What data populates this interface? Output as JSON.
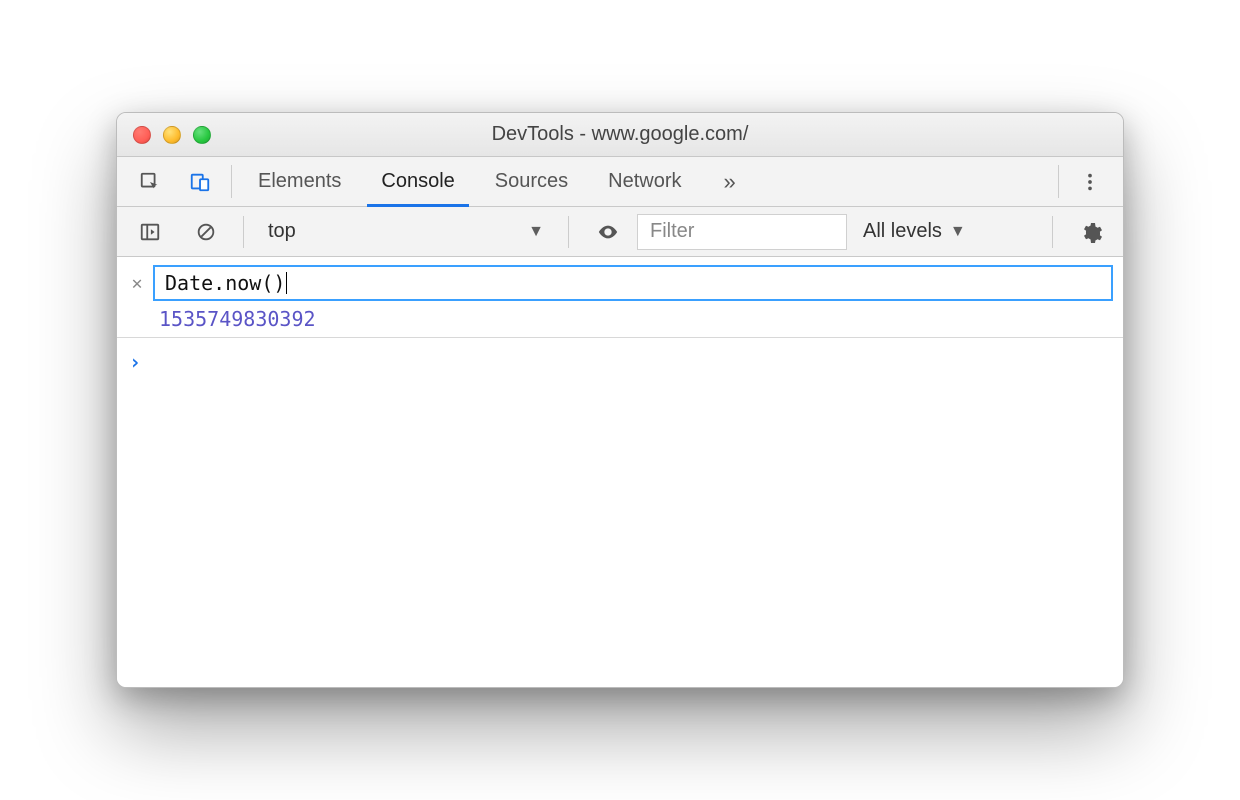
{
  "window": {
    "title": "DevTools - www.google.com/"
  },
  "tabs": {
    "elements": "Elements",
    "console": "Console",
    "sources": "Sources",
    "network": "Network"
  },
  "subbar": {
    "context": "top",
    "filter_placeholder": "Filter",
    "filter_value": "",
    "levels": "All levels"
  },
  "console": {
    "expression": "Date.now()",
    "result": "1535749830392"
  }
}
